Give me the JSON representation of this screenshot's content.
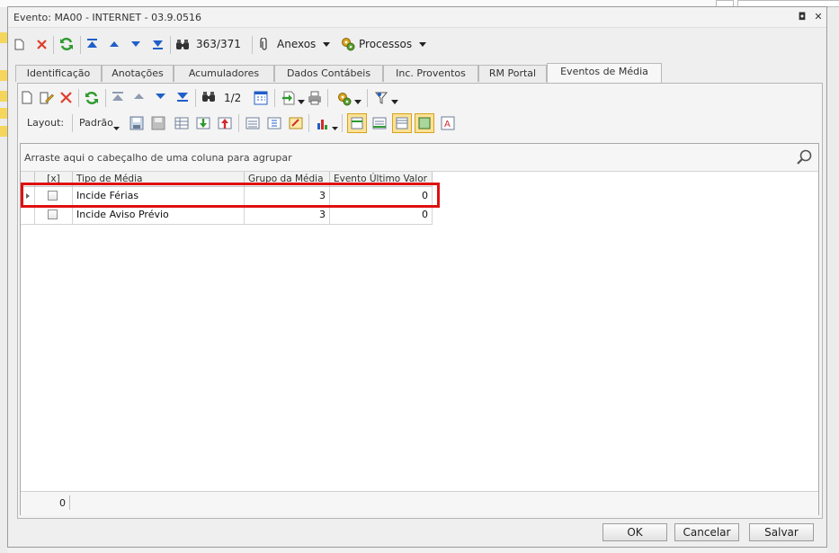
{
  "window": {
    "title": "Evento: MA00 - INTERNET - 03.9.0516",
    "restore_glyph": "◘",
    "close_glyph": "✕"
  },
  "toolbar": {
    "record_counter": "363/371",
    "anexos_label": "Anexos",
    "processos_label": "Processos"
  },
  "tabs": [
    {
      "label": "Identificação"
    },
    {
      "label": "Anotações"
    },
    {
      "label": "Acumuladores"
    },
    {
      "label": "Dados Contábeis"
    },
    {
      "label": "Inc. Proventos"
    },
    {
      "label": "RM Portal"
    },
    {
      "label": "Eventos de Média"
    }
  ],
  "active_tab": "Eventos de Média",
  "grid_toolbar": {
    "page_counter": "1/2",
    "layout_label": "Layout:",
    "padrao_label": "Padrão"
  },
  "grid": {
    "group_hint": "Arraste aqui o cabeçalho de uma coluna para agrupar",
    "columns": {
      "select": "[x]",
      "tipo": "Tipo de Média",
      "grupo": "Grupo da Média",
      "evento": "Evento Último Valor"
    },
    "rows": [
      {
        "tipo": "Incide Férias",
        "grupo": "3",
        "evento": "0",
        "checked": false
      },
      {
        "tipo": "Incide Aviso Prévio",
        "grupo": "3",
        "evento": "0",
        "checked": false
      }
    ],
    "footer_count": "0"
  },
  "buttons": {
    "ok": "OK",
    "cancelar": "Cancelar",
    "salvar": "Salvar"
  },
  "colors": {
    "highlight": "#e01010",
    "refresh_green": "#2e9a2e",
    "delete_red": "#e03c2c",
    "nav_blue": "#1f5fc9"
  }
}
